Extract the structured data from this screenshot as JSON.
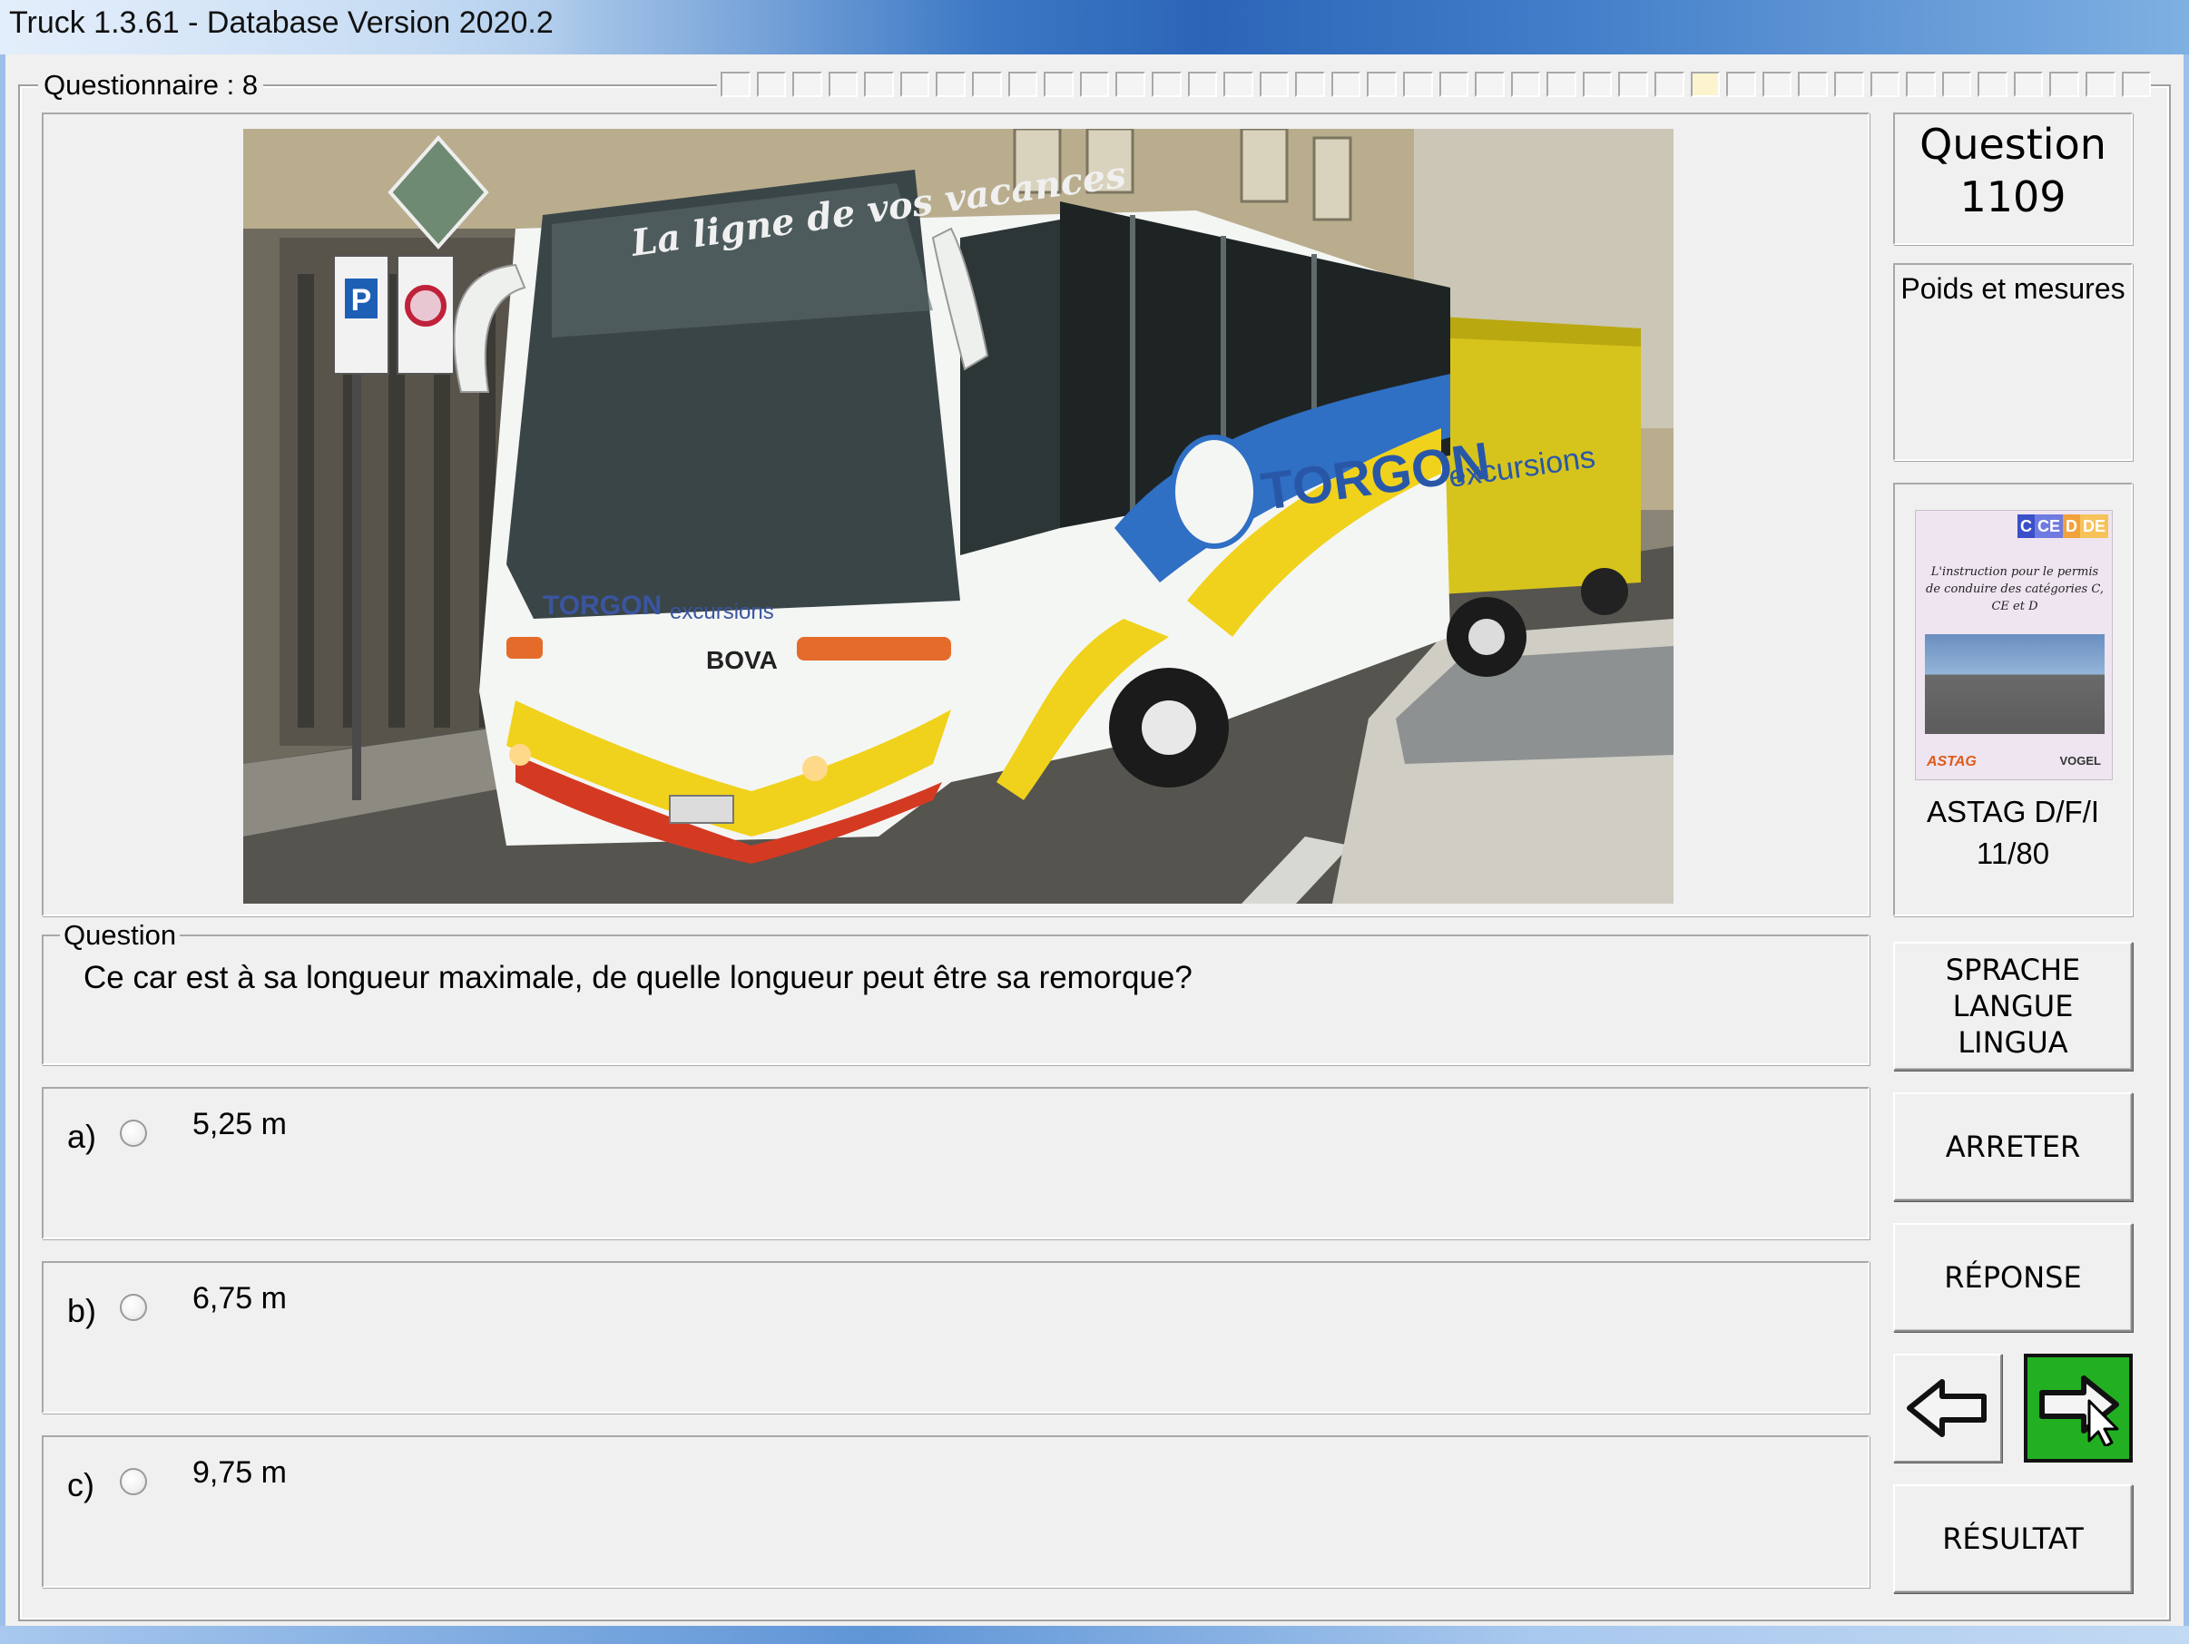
{
  "window": {
    "title": "Truck 1.3.61 - Database Version 2020.2"
  },
  "questionnaire": {
    "label": "Questionnaire : 8",
    "progress_total": 40,
    "progress_current": 28
  },
  "photo": {
    "banner": "La ligne de vos vacances",
    "brand": "TORGON",
    "brand_sub": "excursions",
    "maker": "BOVA",
    "sign_parking": "P"
  },
  "question": {
    "legend": "Question",
    "text": "Ce car est à sa longueur maximale, de quelle longueur peut être sa remorque?"
  },
  "answers": [
    {
      "letter": "a)",
      "text": "5,25 m"
    },
    {
      "letter": "b)",
      "text": "6,75 m"
    },
    {
      "letter": "c)",
      "text": "9,75 m"
    }
  ],
  "question_number": {
    "label": "Question",
    "number": "1109"
  },
  "category": "Poids et mesures",
  "book": {
    "categories": [
      {
        "label": "C",
        "color": "#3a4fc8"
      },
      {
        "label": "CE",
        "color": "#6f7be0"
      },
      {
        "label": "D",
        "color": "#f2a23a"
      },
      {
        "label": "DE",
        "color": "#f7c25a"
      }
    ],
    "cover_text": "L'instruction pour le permis de conduire des catégories C, CE et D",
    "logo_left": "ASTAG",
    "logo_right": "VOGEL",
    "caption": "ASTAG D/F/I",
    "page": "11/80"
  },
  "buttons": {
    "language_lines": [
      "SPRACHE",
      "LANGUE",
      "LINGUA"
    ],
    "stop": "ARRETER",
    "answer": "RÉPONSE",
    "result": "RÉSULTAT"
  },
  "icons": {
    "prev": "arrow-left-icon",
    "next": "arrow-right-icon",
    "cursor": "mouse-pointer-icon"
  }
}
